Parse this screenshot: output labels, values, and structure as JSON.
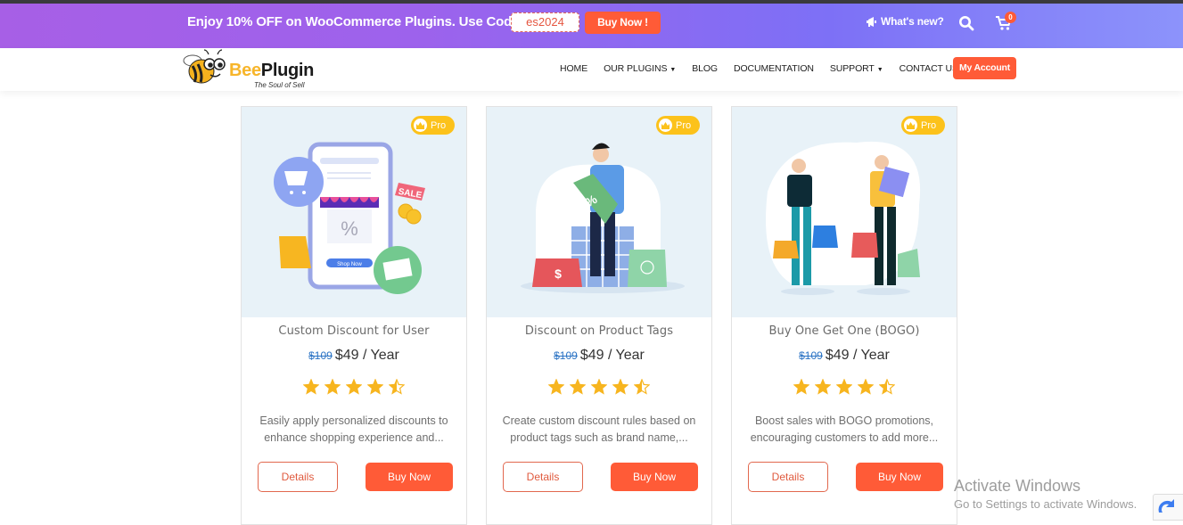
{
  "promo": {
    "text": "Enjoy 10% OFF on WooCommerce Plugins. Use Code:",
    "code": "es2024",
    "buy_label": "Buy Now !",
    "whats_new": "What's new?",
    "cart_count": "0",
    "icons": {
      "megaphone": "megaphone-icon",
      "search": "search-icon",
      "cart": "cart-icon"
    }
  },
  "brand": {
    "name_first": "Bee",
    "name_rest": "Plugin",
    "tagline": "The Soul of Sell"
  },
  "nav": {
    "items": [
      {
        "label": "HOME",
        "dropdown": false
      },
      {
        "label": "OUR PLUGINS",
        "dropdown": true
      },
      {
        "label": "BLOG",
        "dropdown": false
      },
      {
        "label": "DOCUMENTATION",
        "dropdown": false
      },
      {
        "label": "SUPPORT",
        "dropdown": true
      },
      {
        "label": "CONTACT US",
        "dropdown": false
      }
    ],
    "caret": "▼",
    "account_label": "My Account"
  },
  "products": [
    {
      "badge": "Pro",
      "title": "Custom Discount for User",
      "old_price": "$109",
      "price": "$49 / Year",
      "rating": 4.5,
      "description_line1": "Easily apply personalized discounts to",
      "description_line2": "enhance shopping experience and...",
      "details_label": "Details",
      "buy_label": "Buy Now",
      "illustration": "mobile-shop-illustration"
    },
    {
      "badge": "Pro",
      "title": "Discount on Product Tags",
      "old_price": "$109",
      "price": "$49 / Year",
      "rating": 4.5,
      "description_line1": "Create custom discount rules based on",
      "description_line2": "product tags such as brand name,...",
      "details_label": "Details",
      "buy_label": "Buy Now",
      "illustration": "man-with-tag-illustration"
    },
    {
      "badge": "Pro",
      "title": "Buy One Get One (BOGO)",
      "old_price": "$109",
      "price": "$49 / Year",
      "rating": 4.5,
      "description_line1": "Boost sales with BOGO promotions,",
      "description_line2": "encouraging customers to add more...",
      "details_label": "Details",
      "buy_label": "Buy Now",
      "illustration": "shoppers-illustration"
    }
  ],
  "watermark": {
    "line1": "Activate Windows",
    "line2": "Go to Settings to activate Windows."
  },
  "colors": {
    "accent": "#ff5b37",
    "star": "#f7b51f",
    "pro_badge": "#fcc21b",
    "old_price": "#2b73c4",
    "promo_gradient_start": "#a75fe6",
    "promo_gradient_end": "#8c93fb"
  }
}
